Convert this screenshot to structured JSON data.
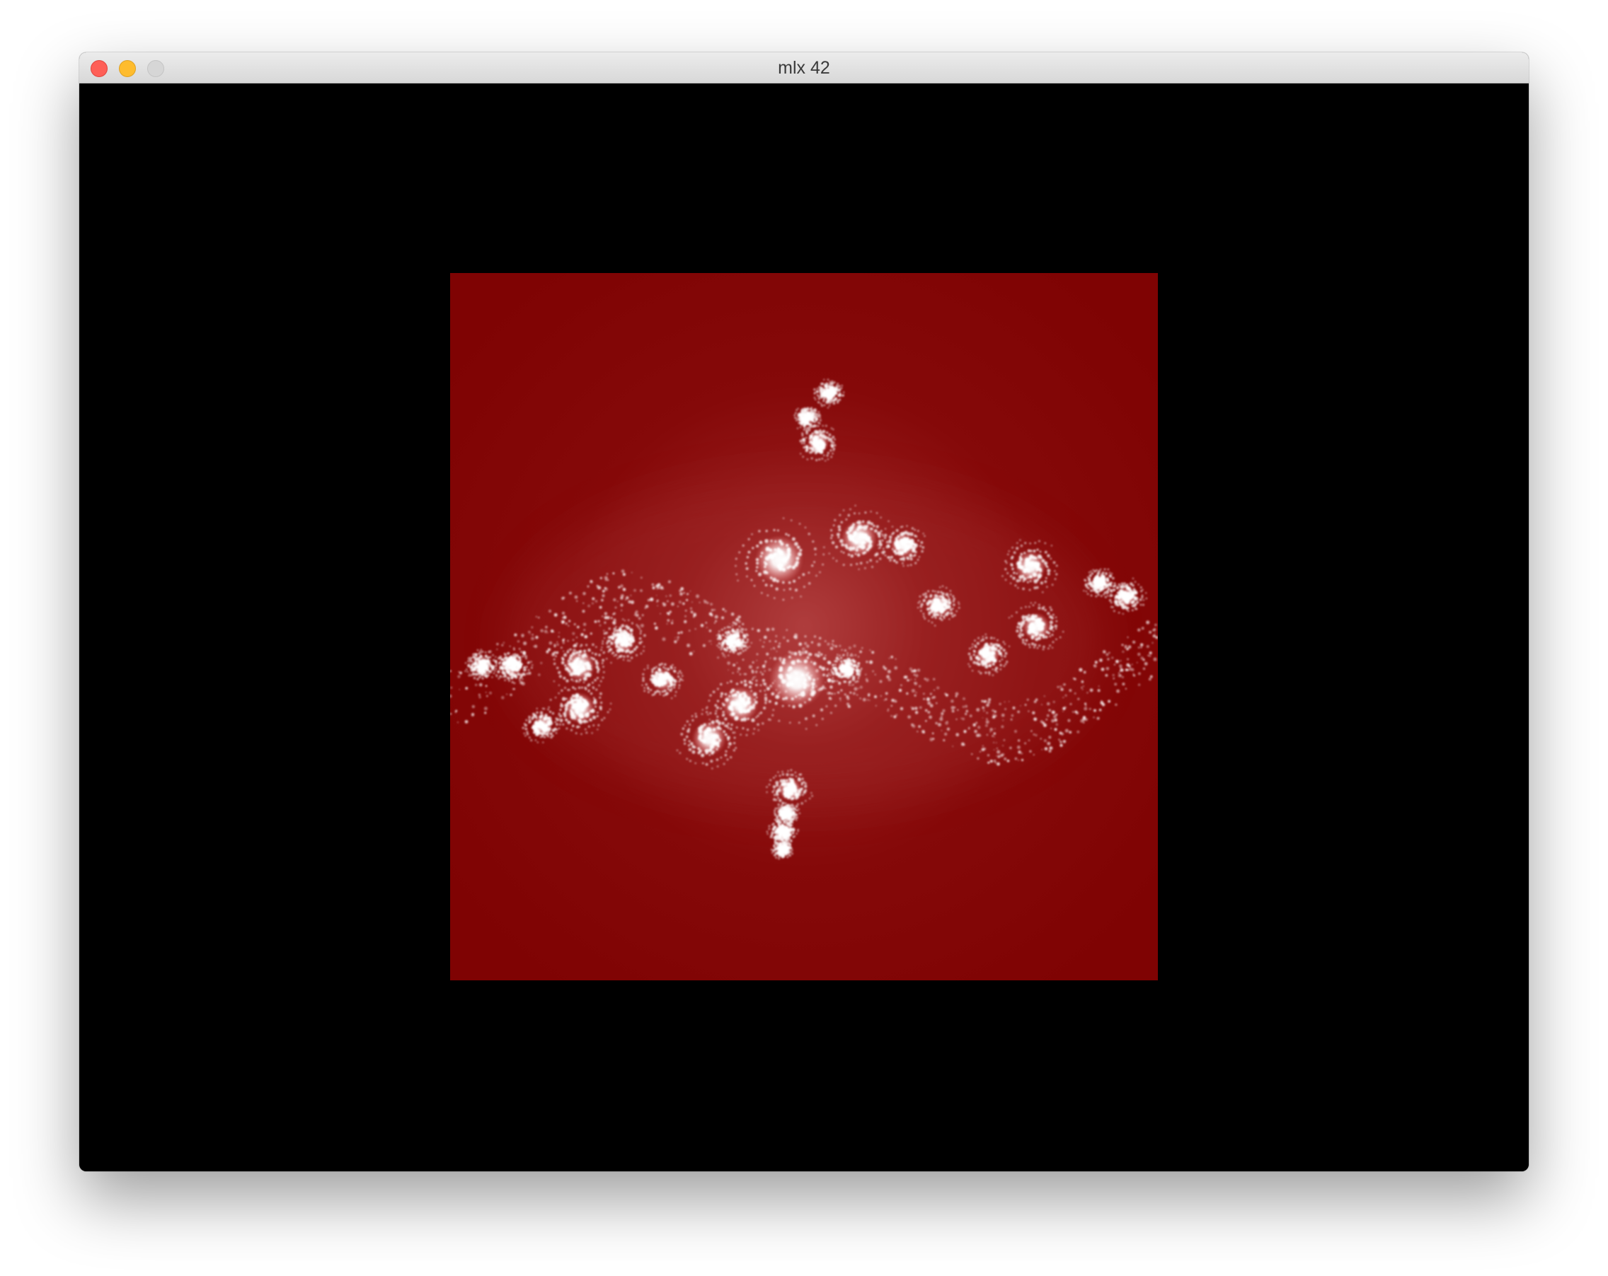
{
  "window": {
    "title": "mlx 42",
    "buttons": {
      "close": "close",
      "minimize": "minimize",
      "zoom": "zoom"
    }
  },
  "viewport": {
    "background_color": "#000000",
    "render": {
      "fractal": "julia",
      "fill_color": "#7f0303",
      "glow_color": "#ffffff"
    }
  }
}
